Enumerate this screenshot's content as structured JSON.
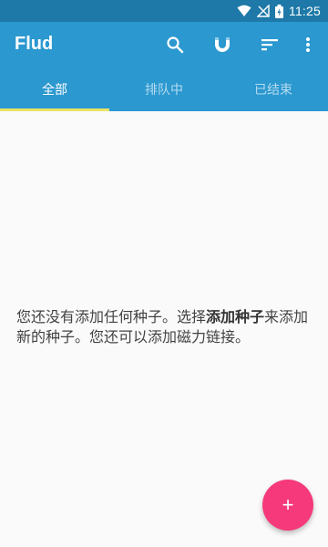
{
  "status_bar": {
    "time": "11:25",
    "icons": [
      "wifi-icon",
      "signal-off-icon",
      "battery-charging-icon"
    ]
  },
  "app_bar": {
    "title": "Flud",
    "actions": [
      "search-icon",
      "magnet-icon",
      "sort-icon",
      "more-vert-icon"
    ]
  },
  "tabs": [
    {
      "label": "全部",
      "active": true
    },
    {
      "label": "排队中",
      "active": false
    },
    {
      "label": "已结束",
      "active": false
    }
  ],
  "empty_state": {
    "text_before": "您还没有添加任何种子。选择",
    "text_bold": "添加种子",
    "text_after": "来添加新的种子。您还可以添加磁力链接。"
  },
  "fab": {
    "label": "+"
  },
  "colors": {
    "status_bar": "#1e79a8",
    "app_bar": "#2b98d0",
    "tab_indicator": "#e9e366",
    "fab": "#f5397a",
    "background": "#fafafa"
  }
}
